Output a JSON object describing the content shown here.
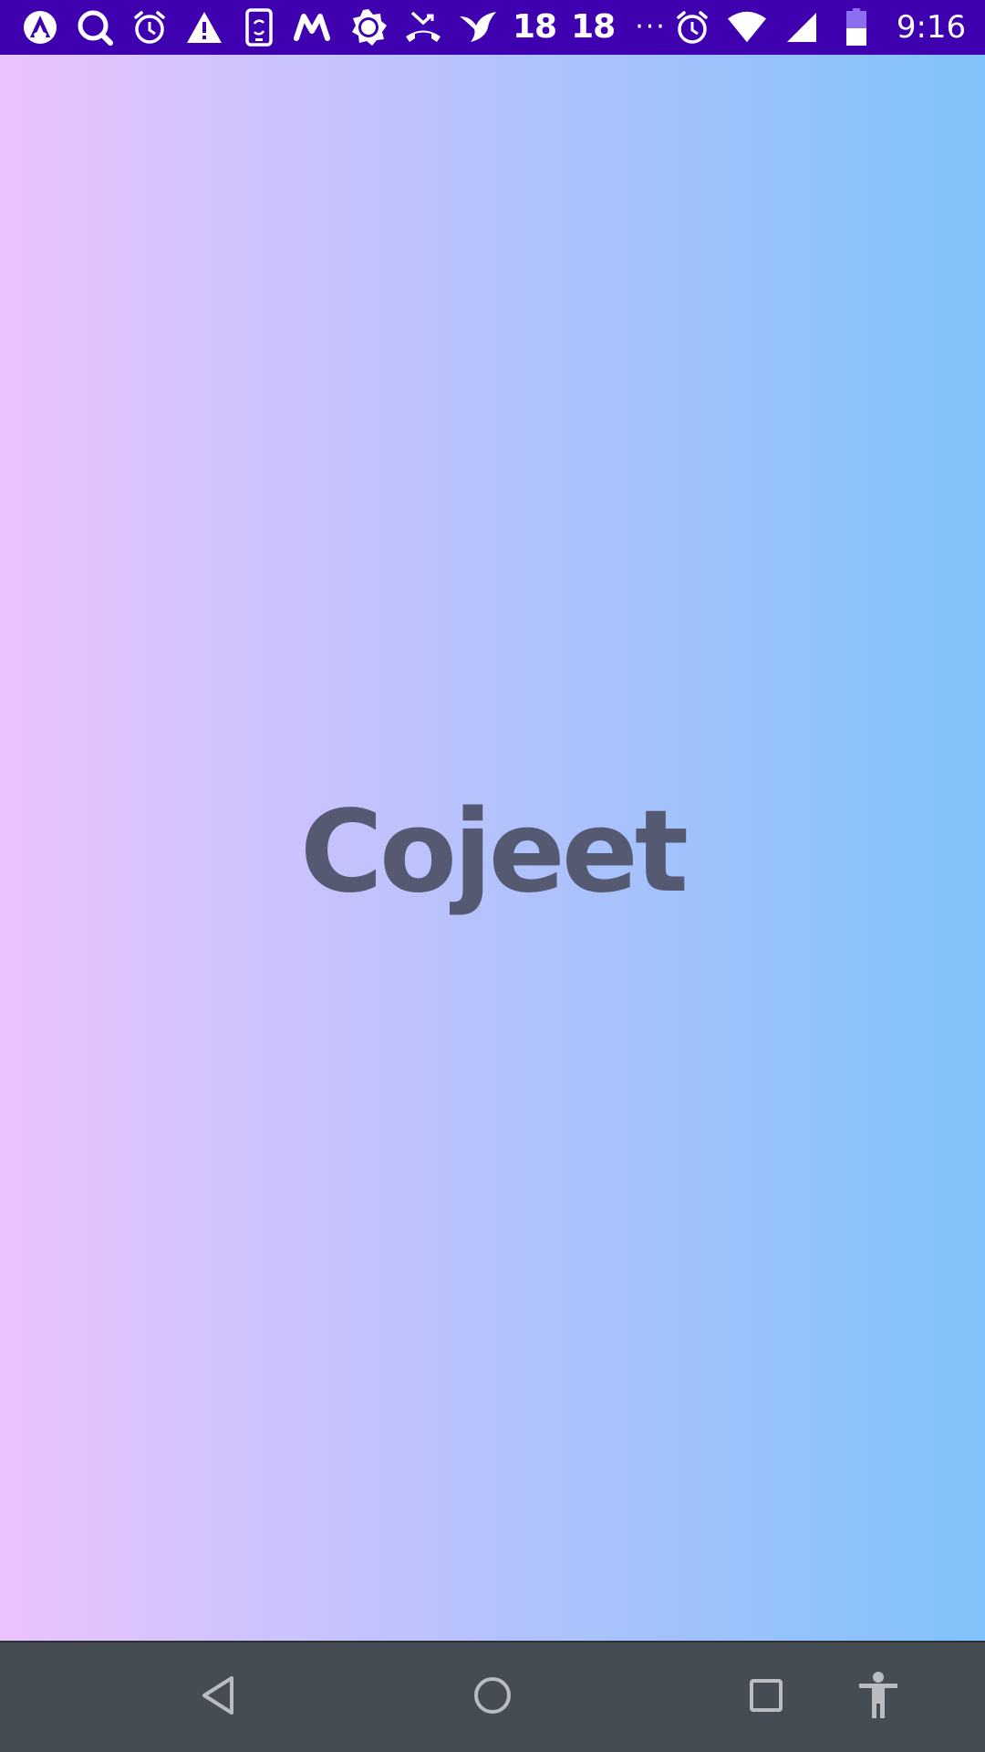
{
  "status_bar": {
    "background_color": "#3f00b0",
    "left_icons": [
      "android-auto-icon",
      "search-icon",
      "alarm-icon",
      "warning-icon",
      "phone-sync-icon",
      "myntra-icon",
      "brightness-icon",
      "missed-call-icon",
      "bird-icon"
    ],
    "badge_1": "18",
    "badge_2": "18",
    "more_indicator": "···",
    "right_icons": [
      "alarm-icon",
      "wifi-icon",
      "cellular-signal-icon",
      "battery-icon"
    ],
    "time": "9:16"
  },
  "main": {
    "title": "Cojeet",
    "gradient_start_color": "#eac3fd",
    "gradient_end_color": "#80c2fb",
    "title_color": "#555a72"
  },
  "nav_bar": {
    "background_color": "#454c53",
    "buttons": [
      "back-icon",
      "home-icon",
      "recents-icon",
      "accessibility-icon"
    ]
  }
}
